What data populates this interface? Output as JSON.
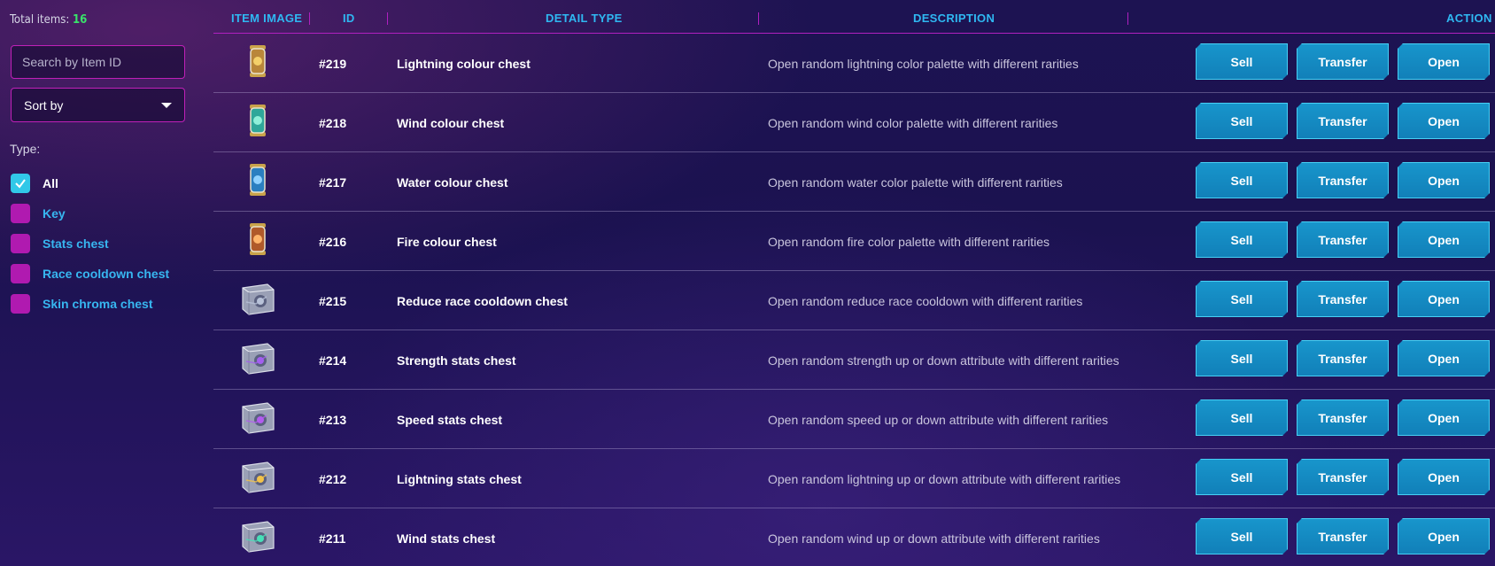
{
  "sidebar": {
    "total_label": "Total items:",
    "total_count": "16",
    "search_placeholder": "Search by Item ID",
    "sort_label": "Sort by",
    "type_label": "Type:",
    "filters": [
      {
        "label": "All",
        "checked": true
      },
      {
        "label": "Key",
        "checked": false
      },
      {
        "label": "Stats chest",
        "checked": false
      },
      {
        "label": "Race cooldown chest",
        "checked": false
      },
      {
        "label": "Skin chroma chest",
        "checked": false
      }
    ]
  },
  "table": {
    "headers": {
      "image": "ITEM IMAGE",
      "id": "ID",
      "type": "DETAIL TYPE",
      "description": "DESCRIPTION",
      "action": "ACTION"
    },
    "buttons": {
      "sell": "Sell",
      "transfer": "Transfer",
      "open": "Open"
    },
    "rows": [
      {
        "id": "#219",
        "type": "Lightning colour chest",
        "description": "Open random lightning color palette with different rarities",
        "icon": "lightning-capsule-icon"
      },
      {
        "id": "#218",
        "type": "Wind colour chest",
        "description": "Open random wind color palette with different rarities",
        "icon": "wind-capsule-icon"
      },
      {
        "id": "#217",
        "type": "Water colour chest",
        "description": "Open random water color palette with different rarities",
        "icon": "water-capsule-icon"
      },
      {
        "id": "#216",
        "type": "Fire colour chest",
        "description": "Open random fire color palette with different rarities",
        "icon": "fire-capsule-icon"
      },
      {
        "id": "#215",
        "type": "Reduce race cooldown chest",
        "description": "Open random reduce race cooldown with different rarities",
        "icon": "cooldown-chest-icon"
      },
      {
        "id": "#214",
        "type": "Strength stats chest",
        "description": "Open random strength up or down attribute with different rarities",
        "icon": "strength-chest-icon"
      },
      {
        "id": "#213",
        "type": "Speed stats chest",
        "description": "Open random speed up or down attribute with different rarities",
        "icon": "speed-chest-icon"
      },
      {
        "id": "#212",
        "type": "Lightning stats chest",
        "description": "Open random lightning up or down attribute with different rarities",
        "icon": "lightning-chest-icon"
      },
      {
        "id": "#211",
        "type": "Wind stats chest",
        "description": "Open random wind up or down attribute with different rarities",
        "icon": "wind-chest-icon"
      }
    ]
  },
  "colors": {
    "accent_blue": "#1896cc",
    "filter_magenta": "#b01ab0",
    "count_green": "#39e36a",
    "header_blue": "#2fb8f2"
  }
}
